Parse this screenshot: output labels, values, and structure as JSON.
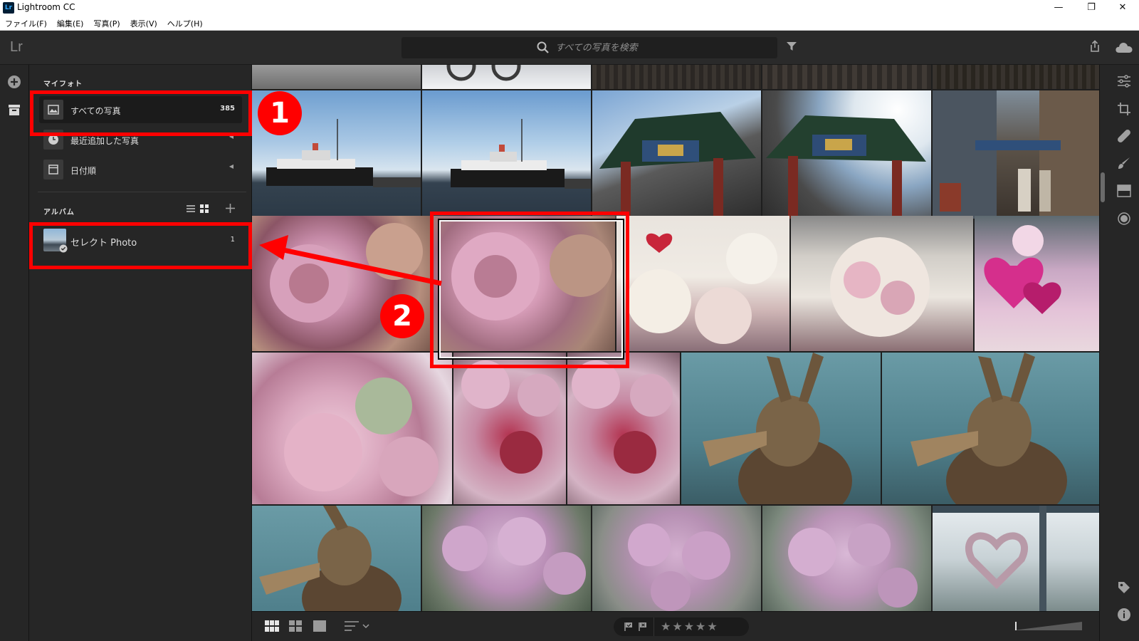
{
  "window": {
    "title": "Lightroom CC",
    "app_icon": "Lr"
  },
  "menu": [
    "ファイル(F)",
    "編集(E)",
    "写真(P)",
    "表示(V)",
    "ヘルプ(H)"
  ],
  "toolbar": {
    "logo": "Lr",
    "search_placeholder": "すべての写真を検索"
  },
  "sidebar": {
    "my_photos_title": "マイフォト",
    "items": [
      {
        "label": "すべての写真",
        "count": "385"
      },
      {
        "label": "最近追加した写真"
      },
      {
        "label": "日付順"
      }
    ],
    "albums_title": "アルバム",
    "albums": [
      {
        "label": "セレクト Photo",
        "count": "1"
      }
    ]
  },
  "annotations": {
    "badge1": "1",
    "badge2": "2",
    "color": "#ff0000"
  },
  "bottombar": {
    "stars": "★★★★★"
  },
  "colors": {
    "background": "#1e1e1e",
    "panel": "#262626",
    "active_item": "#1b1b1b",
    "annotation": "#ff0000"
  },
  "icons": [
    "search-icon",
    "filter-icon",
    "share-icon",
    "cloud-icon",
    "add-icon",
    "library-icon",
    "edit-icon",
    "crop-icon",
    "healing-icon",
    "brush-icon",
    "gradient-icon",
    "radial-icon",
    "tag-icon",
    "info-icon",
    "flag-icon",
    "star-icon"
  ]
}
